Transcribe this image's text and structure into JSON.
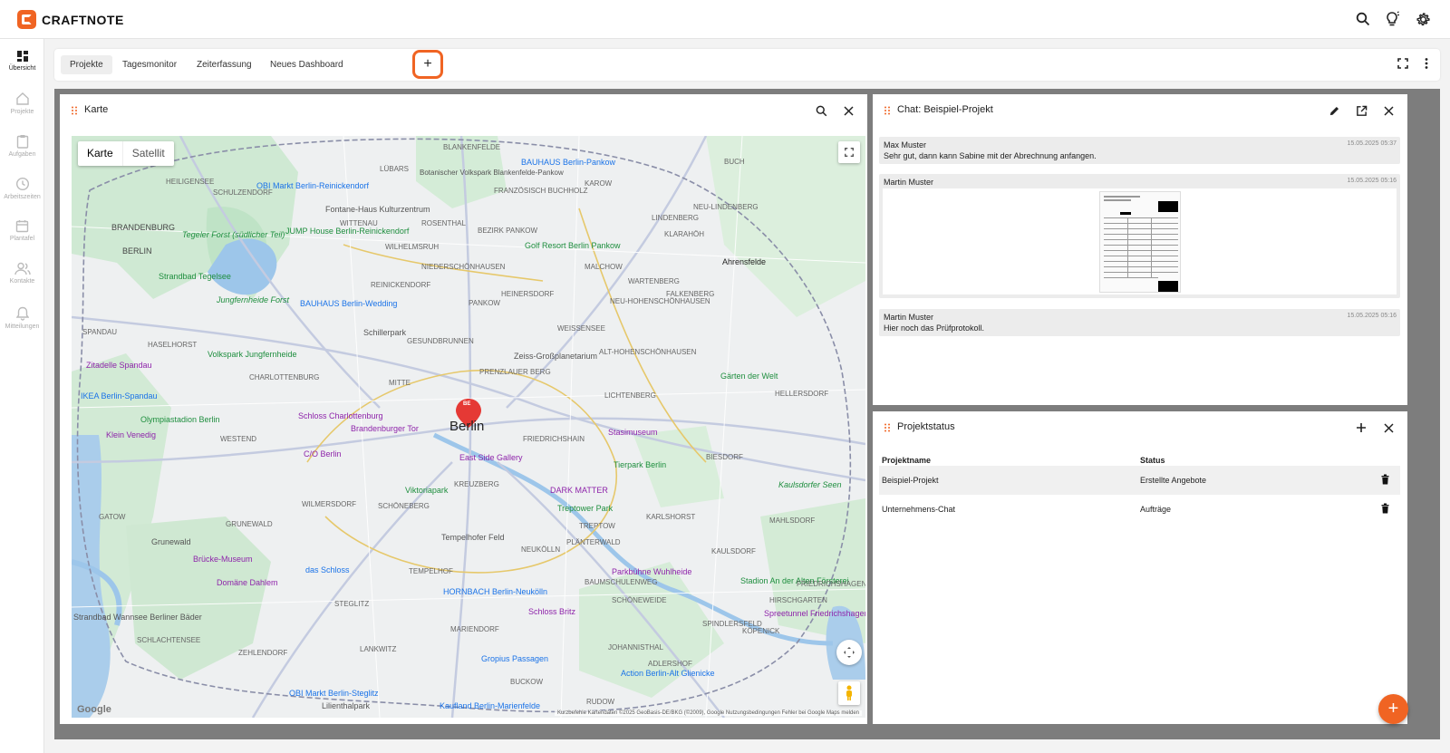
{
  "app": {
    "name": "CRAFTNOTE",
    "brand_color": "#f06423"
  },
  "topbar": {
    "icons": [
      "search-icon",
      "lightbulb-icon",
      "gear-icon"
    ]
  },
  "sidebar": {
    "items": [
      {
        "label": "Übersicht",
        "icon": "dashboard-icon",
        "active": true
      },
      {
        "label": "Projekte",
        "icon": "home-icon",
        "active": false
      },
      {
        "label": "Aufgaben",
        "icon": "clipboard-icon",
        "active": false
      },
      {
        "label": "Arbeitszeiten",
        "icon": "clock-icon",
        "active": false
      },
      {
        "label": "Plantafel",
        "icon": "calendar-icon",
        "active": false
      },
      {
        "label": "Kontakte",
        "icon": "people-icon",
        "active": false
      },
      {
        "label": "Mitteilungen",
        "icon": "bell-icon",
        "active": false
      }
    ]
  },
  "tabs": {
    "items": [
      {
        "label": "Projekte",
        "active": true
      },
      {
        "label": "Tagesmonitor",
        "active": false
      },
      {
        "label": "Zeiterfassung",
        "active": false
      },
      {
        "label": "Neues Dashboard",
        "active": false
      }
    ],
    "add_label": "+"
  },
  "map_panel": {
    "title": "Karte",
    "toggle": {
      "map": "Karte",
      "satellite": "Satellit"
    },
    "city_label": "Berlin",
    "marker_label": "BE",
    "google_label": "Google",
    "attribution": "Kurzbefehle   Kartendaten ©2025 GeoBasis-DE/BKG (©2009), Google   Nutzungsbedingungen   Fehler bei Google Maps melden",
    "places": {
      "p1": "BAUHAUS Berlin-Pankow",
      "p2": "Fontane-Haus Kulturzentrum",
      "p3": "OBI Markt Berlin-Reinickendorf",
      "p4": "JUMP House Berlin-Reinickendorf",
      "p5": "Tegeler Forst (südlicher Teil)",
      "p6": "Golf Resort Berlin Pankow",
      "p7": "Strandbad Tegelsee",
      "p8": "Jungfernheide Forst",
      "p9": "BAUHAUS Berlin-Wedding",
      "p10": "Ahrensfelde",
      "p11": "Volkspark Jungfernheide",
      "p12": "Zeiss-Großplanetarium",
      "p13": "Zitadelle Spandau",
      "p14": "IKEA Berlin-Spandau",
      "p15": "Olympiastadion Berlin",
      "p16": "Schloss Charlottenburg",
      "p17": "Brandenburger Tor",
      "p18": "Klein Venedig",
      "p19": "C/O Berlin",
      "p20": "Stasimuseum",
      "p21": "East Side Gallery",
      "p22": "Tierpark Berlin",
      "p23": "Viktoriapark",
      "p24": "DARK MATTER",
      "p25": "Treptower Park",
      "p26": "Grunewald",
      "p27": "Tempelhofer Feld",
      "p28": "Brücke-Museum",
      "p29": "das Schloss",
      "p30": "Domäne Dahlem",
      "p31": "Parkbühne Wuhlheide",
      "p32": "HORNBACH Berlin-Neukölln",
      "p33": "Schloss Britz",
      "p34": "Stadion An der Alten Försterei",
      "p35": "Spreetunnel Friedrichshagen",
      "p36": "Gropius Passagen",
      "p37": "Action Berlin-Alt Glienicke",
      "p38": "OBI Markt Berlin-Steglitz",
      "p39": "Lilienthalpark",
      "p40": "Kaufland Berlin-Marienfelde",
      "p41": "Gärten der Welt",
      "p42": "Strandbad Wannsee Berliner Bäder",
      "p43": "Botanischer Volkspark Blankenfelde-Pankow",
      "p44": "Kaulsdorfer Seen",
      "p45": "Schillerpark"
    },
    "districts": {
      "d1": "BLANKENFELDE",
      "d2": "LÜBARS",
      "d3": "HEILIGENSEE",
      "d4": "SCHULZENDORF",
      "d5": "FRANZÖSISCH BUCHHOLZ",
      "d6": "KAROW",
      "d7": "BUCH",
      "d8": "BRANDENBURG",
      "d9": "BERLIN",
      "d10": "ROSENTHAL",
      "d11": "NEU-LINDENBERG",
      "d12": "LINDENBERG",
      "d13": "KLARAHÖH",
      "d14": "WITTENAU",
      "d15": "WILHELMSRUH",
      "d16": "BEZIRK PANKOW",
      "d17": "NIEDERSCHÖNHAUSEN",
      "d18": "MALCHOW",
      "d19": "REINICKENDORF",
      "d20": "HEINERSDORF",
      "d21": "WARTENBERG",
      "d22": "FALKENBERG",
      "d23": "PANKOW",
      "d24": "NEU-HOHENSCHÖNHAUSEN",
      "d25": "HASELHORST",
      "d26": "WEISSENSEE",
      "d27": "GESUNDBRUNNEN",
      "d28": "ALT-HOHENSCHÖNHAUSEN",
      "d29": "PRENZLAUER BERG",
      "d30": "LICHTENBERG",
      "d31": "MITTE",
      "d32": "FRIEDRICHSHAIN",
      "d33": "CHARLOTTENBURG",
      "d34": "WESTEND",
      "d35": "SCHÖNEBERG",
      "d36": "KREUZBERG",
      "d37": "NEUKÖLLN",
      "d38": "WILMERSDORF",
      "d39": "GRUNEWALD",
      "d40": "STEGLITZ",
      "d41": "TEMPELHOF",
      "d42": "TREPTOW",
      "d43": "KARLSHORST",
      "d44": "BIESDORF",
      "d45": "KÖPENICK",
      "d46": "ZEHLENDORF",
      "d47": "LANKWITZ",
      "d48": "MARIENDORF",
      "d49": "BUCKOW",
      "d50": "RUDOW",
      "d51": "SPINDLERSFELD",
      "d52": "HELLERSDORF",
      "d53": "MAHLSDORF",
      "d54": "SPANDAU",
      "d55": "GATOW",
      "d56": "SCHLACHTENSEE",
      "d57": "JOHANNISTHAL",
      "d58": "ADLERSHOF",
      "d59": "KAULSDORF",
      "d60": "HIRSCHGARTEN",
      "d61": "FRIEDRICHSHAGEN",
      "d62": "PLÄNTERWALD",
      "d63": "BAUMSCHULENWEG",
      "d64": "SCHÖNEWEIDE"
    }
  },
  "chat_panel": {
    "title": "Chat: Beispiel-Projekt",
    "messages": [
      {
        "author": "Max Muster",
        "time": "15.05.2025 05:37",
        "text": "Sehr gut, dann kann Sabine mit der Abrechnung anfangen."
      },
      {
        "author": "Martin Muster",
        "time": "15.05.2025 05:16",
        "attachment": "document"
      },
      {
        "author": "Martin Muster",
        "time": "15.05.2025 05:16",
        "text": "Hier noch das Prüfprotokoll."
      }
    ]
  },
  "status_panel": {
    "title": "Projektstatus",
    "columns": [
      "Projektname",
      "Status"
    ],
    "rows": [
      {
        "name": "Beispiel-Projekt",
        "status": "Erstellte Angebote"
      },
      {
        "name": "Unternehmens-Chat",
        "status": "Aufträge"
      }
    ]
  },
  "fab": {
    "label": "+"
  }
}
